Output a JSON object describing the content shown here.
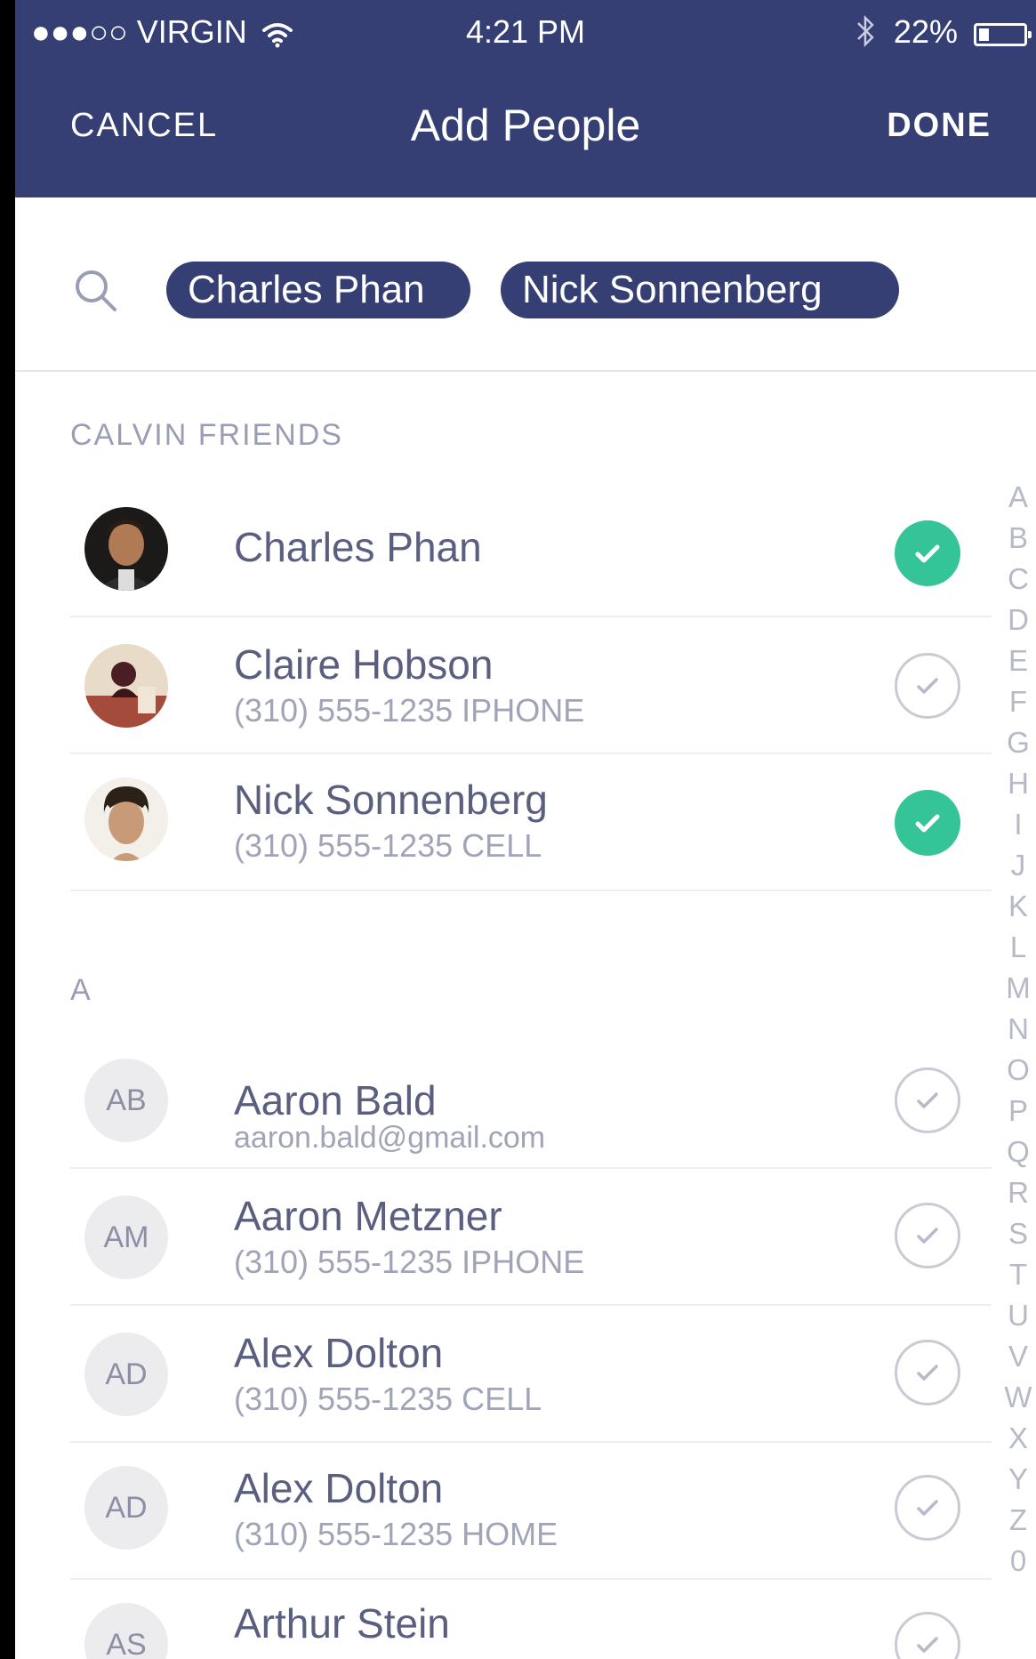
{
  "status_bar": {
    "carrier": "●●●○○ VIRGIN",
    "time": "4:21 PM",
    "battery": "22%",
    "battery_level": 0.22
  },
  "nav": {
    "cancel_label": "CANCEL",
    "title": "Add People",
    "done_label": "DONE"
  },
  "search": {
    "chips": [
      "Charles Phan",
      "Nick Sonnenberg"
    ]
  },
  "sections": {
    "calvin_friends": {
      "header": "CALVIN FRIENDS",
      "contacts": [
        {
          "name": "Charles Phan",
          "detail": "",
          "selected": true
        },
        {
          "name": "Claire Hobson",
          "detail": "(310) 555-1235  IPHONE",
          "selected": false
        },
        {
          "name": "Nick Sonnenberg",
          "detail": "(310) 555-1235  CELL",
          "selected": true
        }
      ]
    },
    "a": {
      "header": "A",
      "contacts": [
        {
          "initials": "AB",
          "name": "Aaron Bald",
          "detail": "aaron.bald@gmail.com",
          "selected": false
        },
        {
          "initials": "AM",
          "name": "Aaron Metzner",
          "detail": "(310) 555-1235  IPHONE",
          "selected": false
        },
        {
          "initials": "AD",
          "name": "Alex Dolton",
          "detail": "(310) 555-1235  CELL",
          "selected": false
        },
        {
          "initials": "AD",
          "name": "Alex Dolton",
          "detail": "(310) 555-1235  HOME",
          "selected": false
        },
        {
          "initials": "AS",
          "name": "Arthur Stein",
          "detail": "",
          "selected": false
        }
      ]
    }
  },
  "index_letters": [
    "A",
    "B",
    "C",
    "D",
    "E",
    "F",
    "G",
    "H",
    "I",
    "J",
    "K",
    "L",
    "M",
    "N",
    "O",
    "P",
    "Q",
    "R",
    "S",
    "T",
    "U",
    "V",
    "W",
    "X",
    "Y",
    "Z",
    "0"
  ],
  "colors": {
    "header_bg": "#353f74",
    "selected_check": "#35c497",
    "name_text": "#5a5f80"
  }
}
